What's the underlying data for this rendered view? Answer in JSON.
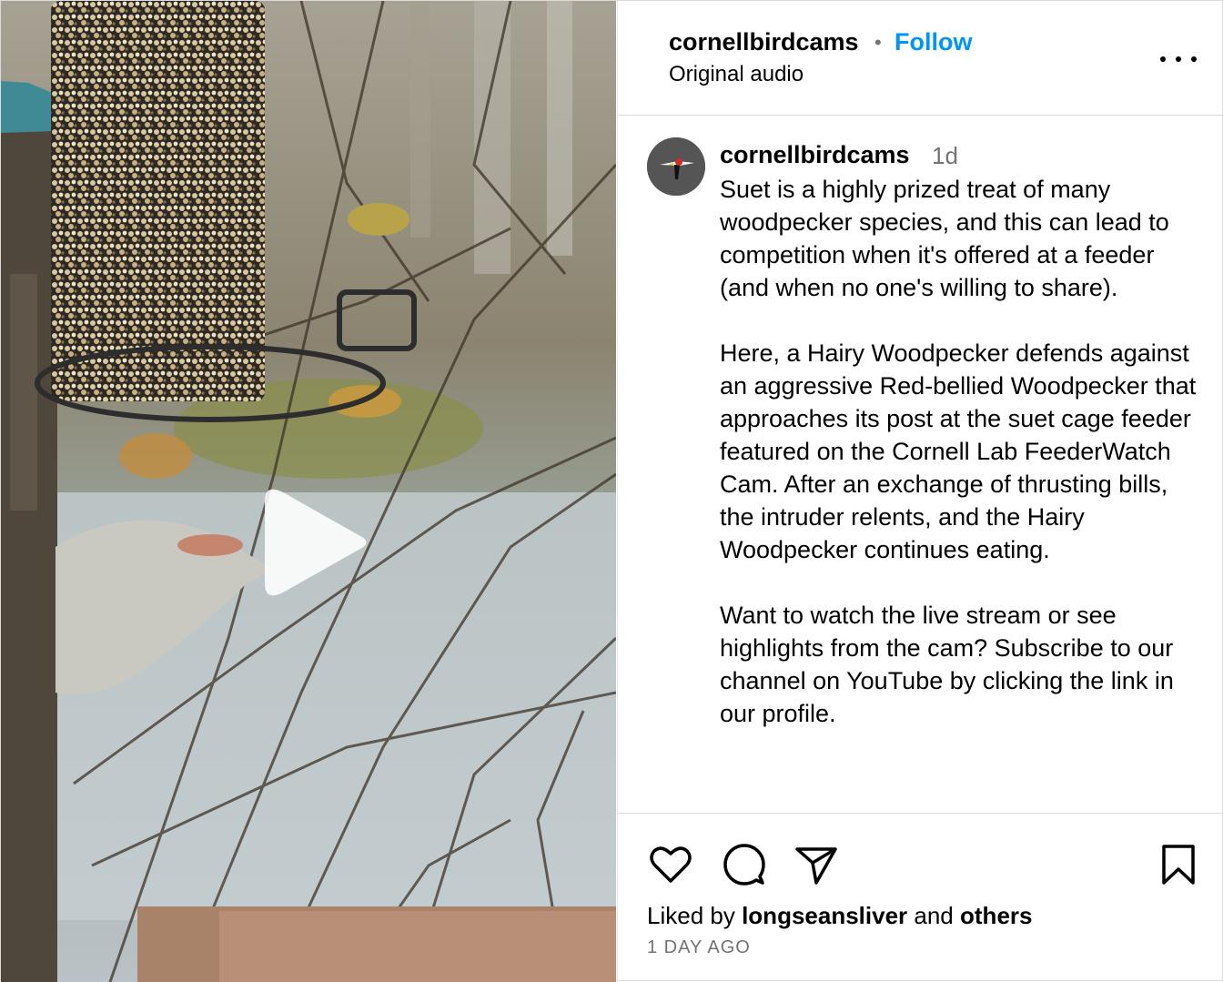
{
  "header": {
    "username": "cornellbirdcams",
    "separator": "•",
    "follow_label": "Follow",
    "audio_label": "Original audio",
    "more_icon": "more-horizontal-icon"
  },
  "caption": {
    "username": "cornellbirdcams",
    "time_ago": "1d",
    "paragraphs": [
      "Suet is a highly prized treat of many woodpecker species, and this can lead to competition when it's offered at a feeder (and when no one's willing to share).",
      "Here, a Hairy Woodpecker defends against an aggressive Red-bellied Woodpecker that approaches its post at the suet cage feeder featured on the Cornell Lab FeederWatch Cam. After an exchange of thrusting bills, the intruder relents, and the Hairy Woodpecker continues eating.",
      "Want to watch the live stream or see highlights from the cam? Subscribe to our channel on YouTube by clicking the link in our profile."
    ]
  },
  "actions": {
    "icons": [
      "heart-icon",
      "comment-icon",
      "share-icon",
      "bookmark-icon"
    ],
    "liked_by_prefix": "Liked by",
    "liked_by_user": "longseansliver",
    "liked_by_and": "and",
    "liked_by_others": "others",
    "date": "1 DAY AGO"
  },
  "media": {
    "type": "video",
    "play_icon": "play-icon"
  },
  "colors": {
    "follow": "#0095f6",
    "muted": "#737373",
    "divider": "#dbdbdb"
  }
}
